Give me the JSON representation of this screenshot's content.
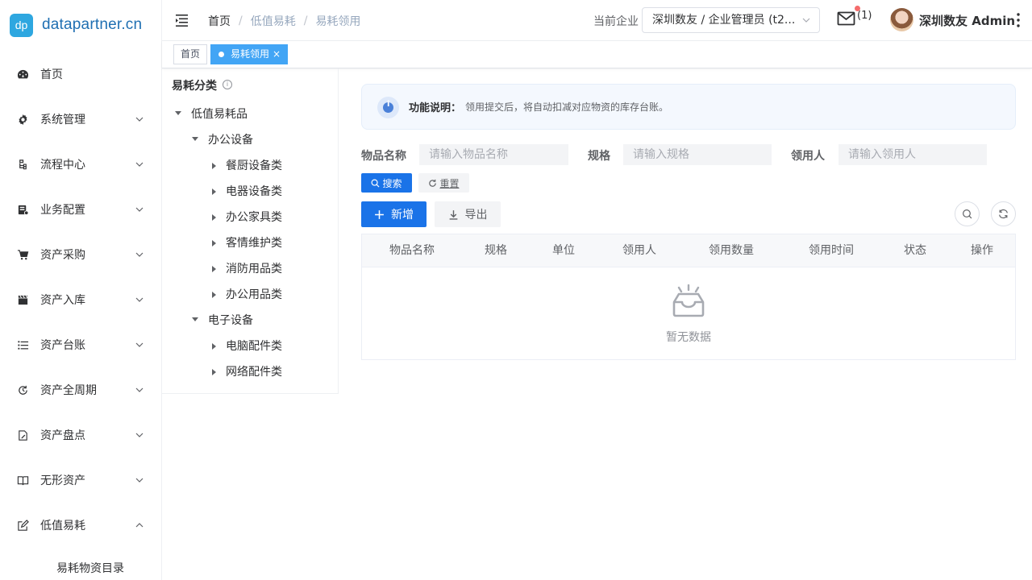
{
  "brand": {
    "badge": "dp",
    "name": "datapartner.cn"
  },
  "sidebar": {
    "items": [
      {
        "label": "首页",
        "icon": "dashboard-icon"
      },
      {
        "label": "系统管理",
        "icon": "gear-icon"
      },
      {
        "label": "流程中心",
        "icon": "flow-icon"
      },
      {
        "label": "业务配置",
        "icon": "config-icon"
      },
      {
        "label": "资产采购",
        "icon": "cart-icon"
      },
      {
        "label": "资产入库",
        "icon": "clapper-icon"
      },
      {
        "label": "资产台账",
        "icon": "list-icon"
      },
      {
        "label": "资产全周期",
        "icon": "cycle-icon"
      },
      {
        "label": "资产盘点",
        "icon": "edit-doc-icon"
      },
      {
        "label": "无形资产",
        "icon": "book-icon"
      },
      {
        "label": "低值易耗",
        "icon": "edit-icon"
      }
    ],
    "submenu_label": "易耗物资目录"
  },
  "header": {
    "breadcrumb": [
      "首页",
      "低值易耗",
      "易耗领用"
    ],
    "enterprise_label": "当前企业",
    "enterprise_value": "深圳数友 / 企业管理员 (t2...",
    "mail_count": "(1)",
    "username": "深圳数友 Admin"
  },
  "tags": {
    "home": "首页",
    "active": "易耗领用",
    "close": "×"
  },
  "tree": {
    "title": "易耗分类",
    "root": "低值易耗品",
    "groups": [
      {
        "label": "办公设备",
        "children": [
          "餐厨设备类",
          "电器设备类",
          "办公家具类",
          "客情维护类",
          "消防用品类",
          "办公用品类"
        ]
      },
      {
        "label": "电子设备",
        "children": [
          "电脑配件类",
          "网络配件类"
        ]
      }
    ]
  },
  "notice": {
    "title": "功能说明：",
    "text": "领用提交后，将自动扣减对应物资的库存台账。"
  },
  "filters": {
    "name_label": "物品名称",
    "name_placeholder": "请输入物品名称",
    "spec_label": "规格",
    "spec_placeholder": "请输入规格",
    "recipient_label": "领用人",
    "recipient_placeholder": "请输入领用人"
  },
  "actions": {
    "search": "搜索",
    "reset": "重置",
    "add": "新增",
    "export": "导出"
  },
  "table": {
    "columns": [
      "物品名称",
      "规格",
      "单位",
      "领用人",
      "领用数量",
      "领用时间",
      "状态",
      "操作"
    ],
    "empty_text": "暂无数据"
  },
  "colors": {
    "primary": "#1a73e8",
    "tag_active": "#42a5f5",
    "logo_bg": "#2ea7e0"
  }
}
